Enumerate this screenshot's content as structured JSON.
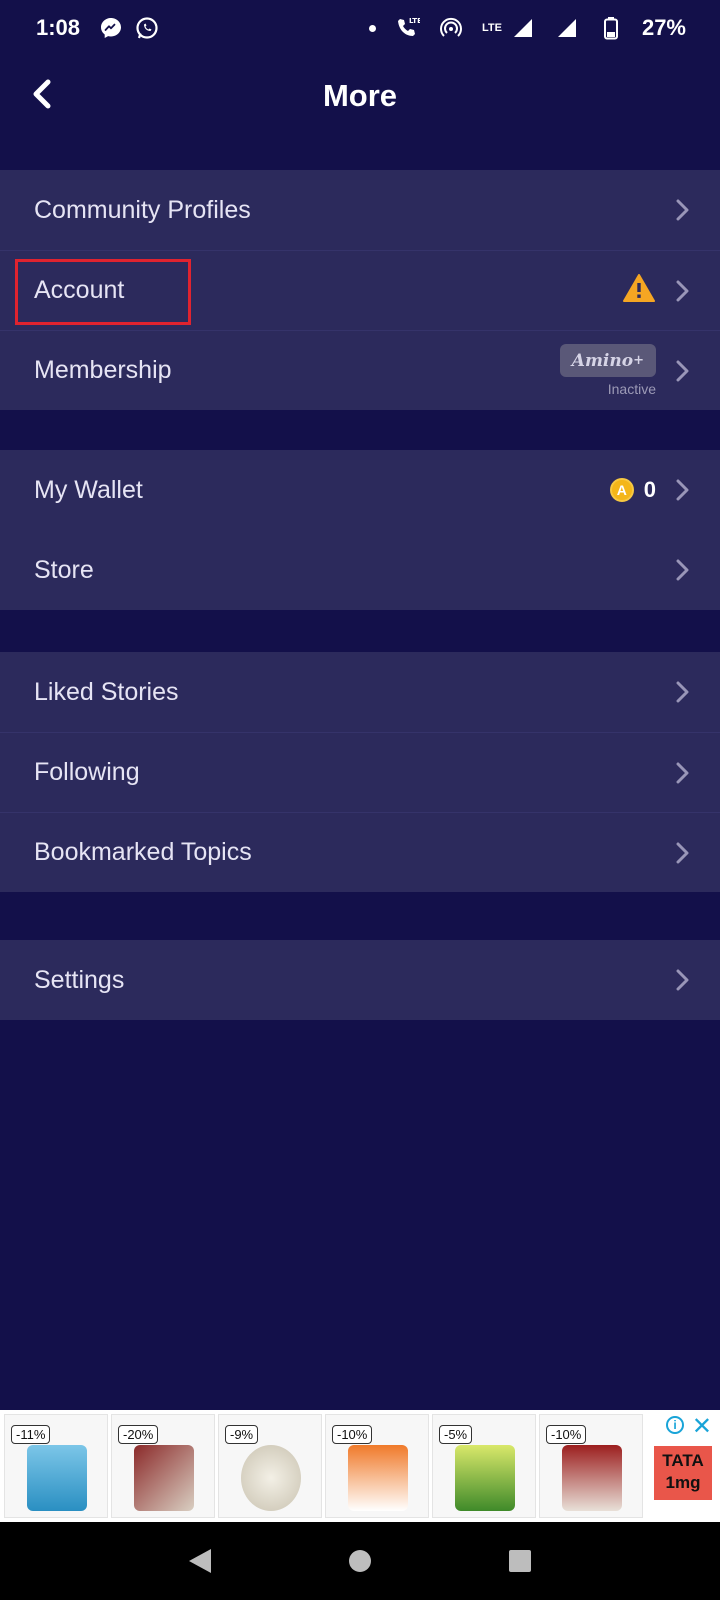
{
  "status_bar": {
    "time": "1:08",
    "battery": "27%",
    "network_labels": [
      "LTE",
      "LTE"
    ]
  },
  "header": {
    "title": "More"
  },
  "sections": [
    {
      "rows": [
        {
          "label": "Community Profiles"
        },
        {
          "label": "Account",
          "warning_icon": "warning-icon"
        },
        {
          "label": "Membership",
          "badge": "Amino",
          "badge_sup": "+",
          "badge_status": "Inactive"
        }
      ]
    },
    {
      "rows": [
        {
          "label": "My Wallet",
          "coin_symbol": "A",
          "coin_count": "0"
        },
        {
          "label": "Store"
        }
      ]
    },
    {
      "rows": [
        {
          "label": "Liked Stories"
        },
        {
          "label": "Following"
        },
        {
          "label": "Bookmarked Topics"
        }
      ]
    },
    {
      "rows": [
        {
          "label": "Settings"
        }
      ]
    }
  ],
  "ad": {
    "discounts": [
      "-11%",
      "-20%",
      "-9%",
      "-10%",
      "-5%",
      "-10%"
    ],
    "brand_logo": "TATA 1mg"
  },
  "colors": {
    "background": "#13104a",
    "section": "#2c2a5c",
    "highlight": "#e0232f",
    "warning": "#f5a623",
    "coin": "#f4b619"
  }
}
